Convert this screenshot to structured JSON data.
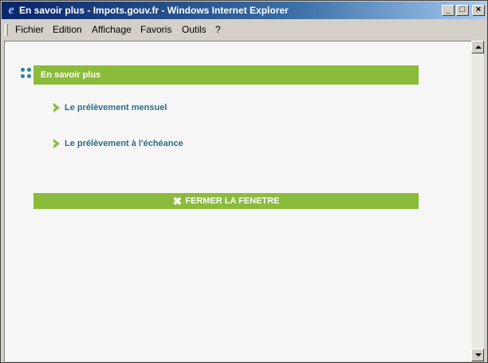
{
  "window": {
    "title": "En savoir plus - Impots.gouv.fr - Windows Internet Explorer",
    "buttons": {
      "minimize": "_",
      "maximize": "□",
      "close": "×"
    }
  },
  "menubar": {
    "items": [
      {
        "label": "Fichier"
      },
      {
        "label": "Edition"
      },
      {
        "label": "Affichage"
      },
      {
        "label": "Favoris"
      },
      {
        "label": "Outils"
      },
      {
        "label": "?"
      }
    ]
  },
  "page": {
    "header": "En savoir plus",
    "links": [
      {
        "label": "Le prélèvement mensuel"
      },
      {
        "label": "Le prélèvement à l'échéance"
      }
    ],
    "close_button": "FERMER LA FENETRE"
  },
  "colors": {
    "accent_green": "#8bbb3b",
    "link_blue": "#2e6e8c",
    "dots_blue": "#2e7fa8",
    "titlebar_start": "#0a246a"
  },
  "icons": {
    "title": "ie-logo-icon",
    "header": "four-dots-icon",
    "links": "chevron-right-icon",
    "close": "close-x-icon"
  }
}
